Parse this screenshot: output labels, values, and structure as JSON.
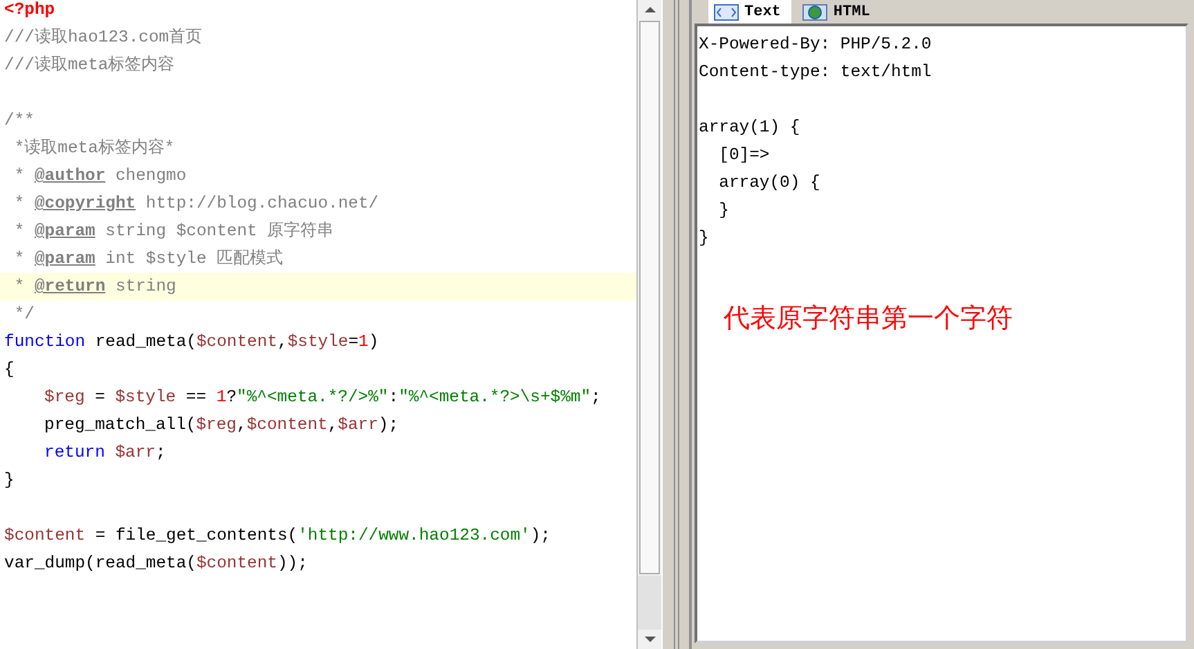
{
  "editor": {
    "lines": [
      {
        "kind": "code",
        "highlighted": false,
        "indented": false,
        "segments": [
          {
            "text": "<?php",
            "kind": "tag"
          }
        ]
      },
      {
        "kind": "code",
        "highlighted": false,
        "indented": false,
        "segments": [
          {
            "text": "///读取hao123.com首页",
            "kind": "comment"
          }
        ]
      },
      {
        "kind": "code",
        "highlighted": false,
        "indented": false,
        "segments": [
          {
            "text": "///读取meta标签内容",
            "kind": "comment"
          }
        ]
      },
      {
        "kind": "blank",
        "highlighted": false
      },
      {
        "kind": "code",
        "highlighted": false,
        "indented": false,
        "segments": [
          {
            "text": "/**",
            "kind": "comment"
          }
        ]
      },
      {
        "kind": "code",
        "highlighted": false,
        "indented": false,
        "segments": [
          {
            "text": " *读取meta标签内容*",
            "kind": "comment"
          }
        ]
      },
      {
        "kind": "code",
        "highlighted": false,
        "indented": false,
        "segments": [
          {
            "text": " * ",
            "kind": "comment"
          },
          {
            "text": "@author",
            "kind": "doctag"
          },
          {
            "text": " chengmo",
            "kind": "comment"
          }
        ]
      },
      {
        "kind": "code",
        "highlighted": false,
        "indented": false,
        "segments": [
          {
            "text": " * ",
            "kind": "comment"
          },
          {
            "text": "@copyright",
            "kind": "doctag"
          },
          {
            "text": " http://blog.chacuo.net/",
            "kind": "comment"
          }
        ]
      },
      {
        "kind": "code",
        "highlighted": false,
        "indented": false,
        "segments": [
          {
            "text": " * ",
            "kind": "comment"
          },
          {
            "text": "@param",
            "kind": "doctag"
          },
          {
            "text": " string $content 原字符串",
            "kind": "comment"
          }
        ]
      },
      {
        "kind": "code",
        "highlighted": false,
        "indented": false,
        "segments": [
          {
            "text": " * ",
            "kind": "comment"
          },
          {
            "text": "@param",
            "kind": "doctag"
          },
          {
            "text": " int $style 匹配模式",
            "kind": "comment"
          }
        ]
      },
      {
        "kind": "code",
        "highlighted": true,
        "indented": false,
        "segments": [
          {
            "text": " * ",
            "kind": "comment"
          },
          {
            "text": "@return",
            "kind": "doctag"
          },
          {
            "text": " string",
            "kind": "comment"
          }
        ]
      },
      {
        "kind": "code",
        "highlighted": false,
        "indented": false,
        "segments": [
          {
            "text": " */",
            "kind": "comment"
          }
        ]
      },
      {
        "kind": "code",
        "highlighted": false,
        "indented": false,
        "segments": [
          {
            "text": "function",
            "kind": "keyword"
          },
          {
            "text": " read_meta(",
            "kind": "plain"
          },
          {
            "text": "$content",
            "kind": "var"
          },
          {
            "text": ",",
            "kind": "plain"
          },
          {
            "text": "$style",
            "kind": "var"
          },
          {
            "text": "=",
            "kind": "plain"
          },
          {
            "text": "1",
            "kind": "number"
          },
          {
            "text": ")",
            "kind": "plain"
          }
        ]
      },
      {
        "kind": "code",
        "highlighted": false,
        "indented": false,
        "segments": [
          {
            "text": "{",
            "kind": "plain"
          }
        ]
      },
      {
        "kind": "code",
        "highlighted": false,
        "indented": true,
        "segments": [
          {
            "text": "$reg",
            "kind": "var"
          },
          {
            "text": " = ",
            "kind": "plain"
          },
          {
            "text": "$style",
            "kind": "var"
          },
          {
            "text": " == ",
            "kind": "plain"
          },
          {
            "text": "1",
            "kind": "number"
          },
          {
            "text": "?",
            "kind": "plain"
          },
          {
            "text": "\"%^<meta.*?/>%\"",
            "kind": "string"
          },
          {
            "text": ":",
            "kind": "plain"
          },
          {
            "text": "\"%^<meta.*?>\\s+$%m\"",
            "kind": "string"
          },
          {
            "text": ";",
            "kind": "plain"
          }
        ]
      },
      {
        "kind": "code",
        "highlighted": false,
        "indented": true,
        "segments": [
          {
            "text": "preg_match_all(",
            "kind": "plain"
          },
          {
            "text": "$reg",
            "kind": "var"
          },
          {
            "text": ",",
            "kind": "plain"
          },
          {
            "text": "$content",
            "kind": "var"
          },
          {
            "text": ",",
            "kind": "plain"
          },
          {
            "text": "$arr",
            "kind": "var"
          },
          {
            "text": ");",
            "kind": "plain"
          }
        ]
      },
      {
        "kind": "code",
        "highlighted": false,
        "indented": true,
        "segments": [
          {
            "text": "return",
            "kind": "keyword"
          },
          {
            "text": " $arr",
            "kind": "var"
          },
          {
            "text": ";",
            "kind": "plain"
          }
        ]
      },
      {
        "kind": "code",
        "highlighted": false,
        "indented": false,
        "segments": [
          {
            "text": "}",
            "kind": "plain"
          }
        ]
      },
      {
        "kind": "blank",
        "highlighted": false
      },
      {
        "kind": "code",
        "highlighted": false,
        "indented": false,
        "segments": [
          {
            "text": "$content",
            "kind": "var"
          },
          {
            "text": " = file_get_contents(",
            "kind": "plain"
          },
          {
            "text": "'http://www.hao123.com'",
            "kind": "string"
          },
          {
            "text": ");",
            "kind": "plain"
          }
        ]
      },
      {
        "kind": "code",
        "highlighted": false,
        "indented": false,
        "segments": [
          {
            "text": "var_dump(read_meta(",
            "kind": "plain"
          },
          {
            "text": "$content",
            "kind": "var"
          },
          {
            "text": "));",
            "kind": "plain"
          }
        ]
      }
    ]
  },
  "output": {
    "tabs": [
      {
        "label": "Text",
        "selected": true
      },
      {
        "label": "HTML",
        "selected": false
      }
    ],
    "headers": [
      "X-Powered-By: PHP/5.2.0",
      "Content-type: text/html"
    ],
    "dump": [
      "array(1) {",
      "  [0]=>",
      "  array(0) {",
      "  }",
      "}"
    ],
    "annotation": "代表原字符串第一个字符"
  }
}
